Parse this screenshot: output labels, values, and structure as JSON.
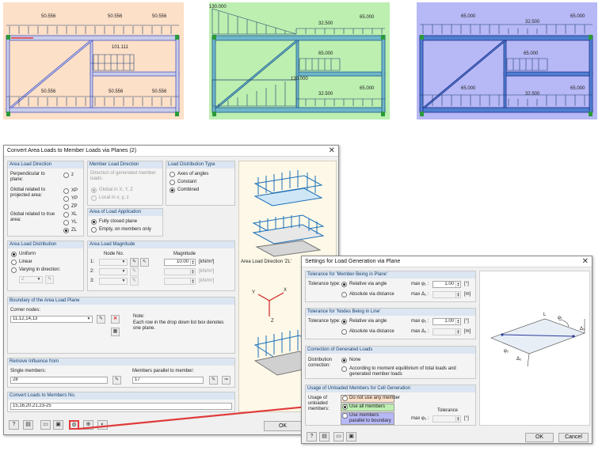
{
  "colors": {
    "panel1": "#fde0c8",
    "panel2": "#bcefb0",
    "panel3": "#b7b8f6",
    "load": "#1f3f6e",
    "accent": "#e03b3b",
    "group": "#dce6f2"
  },
  "panels": [
    {
      "labels": [
        "50.556",
        "50.556",
        "50.556",
        "101.111",
        "50.556",
        "50.556",
        "50.556"
      ]
    },
    {
      "labels": [
        "130.000",
        "32.500",
        "65.000",
        "65.000",
        "130.000",
        "32.500",
        "65.000"
      ]
    },
    {
      "labels": [
        "65.000",
        "32.500",
        "65.000",
        "65.000",
        "65.000",
        "32.500",
        "65.000"
      ]
    }
  ],
  "dlg1": {
    "title": "Convert Area Loads to Member Loads via Planes   (2)",
    "close": "✕",
    "area_dir": {
      "title": "Area Load Direction",
      "perp": "Perpendicular to plane:",
      "z": "z",
      "proj": "Global related to projected area:",
      "xp": "XP",
      "yp": "YP",
      "zp": "ZP",
      "true": "Global related to true area:",
      "xl": "XL",
      "yl": "YL",
      "zl": "ZL"
    },
    "member_dir": {
      "title": "Member Load Direction",
      "desc": "Direction of generated member loads:",
      "global": "Global in X, Y, Z",
      "local": "Local in x, y, z"
    },
    "distribution_type": {
      "title": "Load Distribution Type",
      "axes": "Axes of angles",
      "constant": "Constant",
      "combined": "Combined"
    },
    "application": {
      "title": "Area of Load Application",
      "closed": "Fully closed plane",
      "empty": "Empty, on members only"
    },
    "area_dist": {
      "title": "Area Load Distribution",
      "uniform": "Uniform",
      "linear": "Linear",
      "varying": "Varying in direction:",
      "dir_value": "Z"
    },
    "magnitude": {
      "title": "Area Load Magnitude",
      "node_no": "Node No.",
      "magnitude": "Magnitude",
      "rows": [
        {
          "label": "1:",
          "value": "10.00",
          "unit": "[kN/m²]"
        },
        {
          "label": "2:",
          "value": "",
          "unit": "[kN/m²]"
        },
        {
          "label": "3:",
          "value": "",
          "unit": "[kN/m²]"
        }
      ]
    },
    "boundary": {
      "title": "Boundary of the Area Load Plane",
      "corner_label": "Corner nodes:",
      "corner_value": "11,12,14,13",
      "note_title": "Note:",
      "note_body": "Each row in the drop down list box denotes one plane."
    },
    "remove": {
      "title": "Remove Influence from",
      "single_label": "Single members:",
      "single_value": "28",
      "parallel_label": "Members parallel to member:",
      "parallel_value": "17"
    },
    "convert": {
      "title": "Convert Loads to Members No.",
      "value": "15,16,20,21,23-25"
    },
    "preview_caption": "Area Load Direction 'ZL'",
    "ok": "OK"
  },
  "dlg2": {
    "title": "Settings for Load Generation via Plane",
    "close": "✕",
    "tol_member": {
      "title": "Tolerance for 'Member Being in Plane'",
      "type_label": "Tolerance type:",
      "rel": "Relative via angle",
      "abs": "Absolute via distance",
      "max_phi": "max φ₁ :",
      "phi_value": "1.00",
      "phi_unit": "[°]",
      "max_delta": "max Δ₁ :",
      "delta_unit": "[m]"
    },
    "tol_node": {
      "title": "Tolerance for 'Nodes Being in Line'",
      "type_label": "Tolerance type:",
      "rel": "Relative via angle",
      "abs": "Absolute via distance",
      "max_phi": "max φ₂ :",
      "phi_value": "1.00",
      "phi_unit": "[°]",
      "max_delta": "max Δ₂ :",
      "delta_unit": "[m]"
    },
    "correction": {
      "title": "Correction of Generated Loads",
      "label": "Distribution correction:",
      "none": "None",
      "moment": "According to moment equilibrium of total loads and generated member loads"
    },
    "unloaded": {
      "title": "Usage of Unloaded Members for Cell Generation",
      "label": "Usage of unloaded members:",
      "opt1": "Do not use any member",
      "opt2": "Use all members",
      "opt3": "Use members parallel to boundary",
      "tolerance": "Tolerance",
      "max_phi": "max φ₃ :",
      "phi_unit": "[°]"
    },
    "diagram": {
      "phi1": "φ₁",
      "phi2": "φ₂",
      "delta1": "Δ₁",
      "delta2": "Δ₂",
      "l": "L"
    },
    "ok": "OK",
    "cancel": "Cancel"
  }
}
